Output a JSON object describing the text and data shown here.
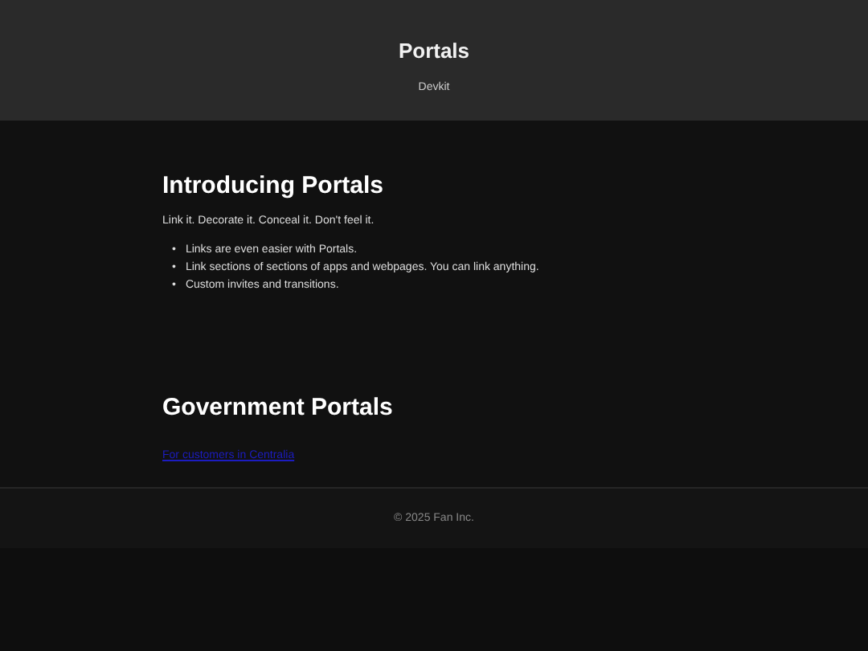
{
  "header": {
    "title": "Portals",
    "subtitle": "Devkit"
  },
  "sections": [
    {
      "heading": "Introducing Portals",
      "paragraph": "Link it. Decorate it. Conceal it. Don't feel it.",
      "bullets": [
        {
          "marker": "•",
          "text": "Links are even easier with Portals."
        },
        {
          "marker": "•",
          "text": "Link sections of sections of apps and webpages. You can link anything."
        },
        {
          "marker": "•",
          "text": "Custom invites and transitions."
        }
      ]
    },
    {
      "heading": "Government Portals",
      "link": "For customers in Centralia"
    }
  ],
  "footer": {
    "text": "© 2025 Fan Inc."
  }
}
